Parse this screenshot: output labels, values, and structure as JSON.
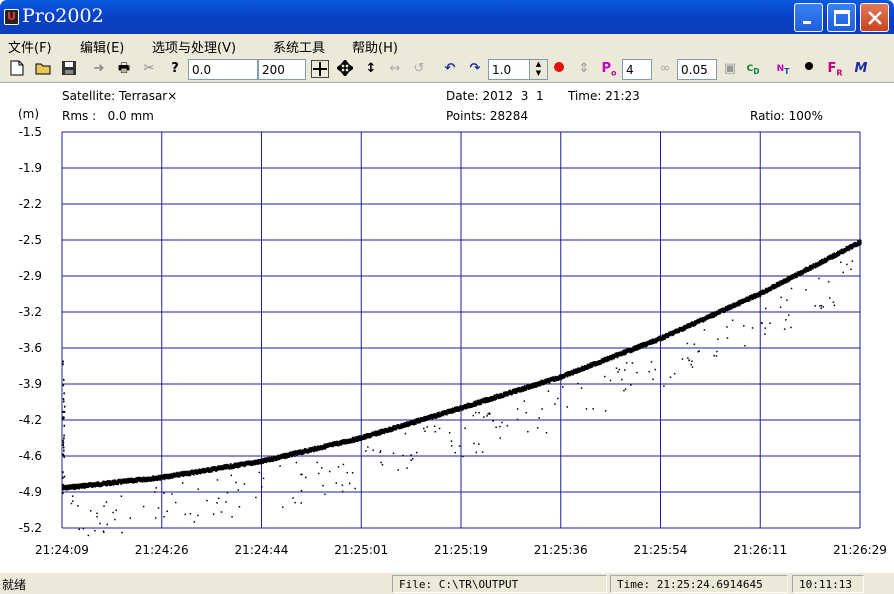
{
  "window": {
    "title": "Pro2002"
  },
  "menu": [
    "文件(F)",
    "编辑(E)",
    "选项与处理(V)",
    "系统工具",
    "帮助(H)"
  ],
  "toolbar": {
    "field1": "0.0",
    "field2": "200",
    "field3": "1.0",
    "field4": "4",
    "field5": "0.05",
    "icons": [
      "new-file-icon",
      "open-folder-icon",
      "save-icon",
      "arrow-right-icon",
      "print-icon",
      "cut-icon",
      "help-icon",
      "zoom-fit-icon",
      "move-icon",
      "vertical-move-icon",
      "horizontal-move-icon",
      "redo-icon",
      "rotate-left-icon",
      "rotate-right-icon",
      "red-dot-icon",
      "vertical-arrows-icon",
      "p-icon",
      "infinity-icon",
      "disk-icon",
      "cd-icon",
      "nt-icon",
      "dot-icon",
      "fr-icon",
      "mu-icon"
    ]
  },
  "header": {
    "satellite": "Satellite: Terrasar×",
    "rms": "Rms :   0.0 mm",
    "date": "Date: 2012  3  1",
    "time": "Time: 21:23",
    "points": "Points: 28284",
    "ratio": "Ratio: 100%",
    "unit": "(m)"
  },
  "chart_data": {
    "type": "scatter",
    "ylabel": "(m)",
    "ylim": [
      -5.2,
      -1.5
    ],
    "yticks": [
      "-1.5",
      "-1.9",
      "-2.2",
      "-2.5",
      "-2.9",
      "-3.2",
      "-3.6",
      "-3.9",
      "-4.2",
      "-4.6",
      "-4.9",
      "-5.2"
    ],
    "xticks": [
      "21:24:09",
      "21:24:26",
      "21:24:44",
      "21:25:01",
      "21:25:19",
      "21:25:36",
      "21:25:54",
      "21:26:11",
      "21:26:29"
    ],
    "grid": true,
    "main_trend": {
      "x": [
        "21:24:09",
        "21:24:26",
        "21:24:44",
        "21:25:01",
        "21:25:19",
        "21:25:36",
        "21:25:54",
        "21:26:11",
        "21:26:29"
      ],
      "y": [
        -4.82,
        -4.72,
        -4.57,
        -4.35,
        -4.07,
        -3.78,
        -3.42,
        -3.0,
        -2.52
      ]
    },
    "colors": {
      "grid": "#1e1e9a",
      "points": "#000000"
    }
  },
  "status": {
    "ready": "就绪",
    "file": "File: C:\\TR\\OUTPUT",
    "time": "Time: 21:25:24.6914645",
    "clock": "10:11:13"
  }
}
